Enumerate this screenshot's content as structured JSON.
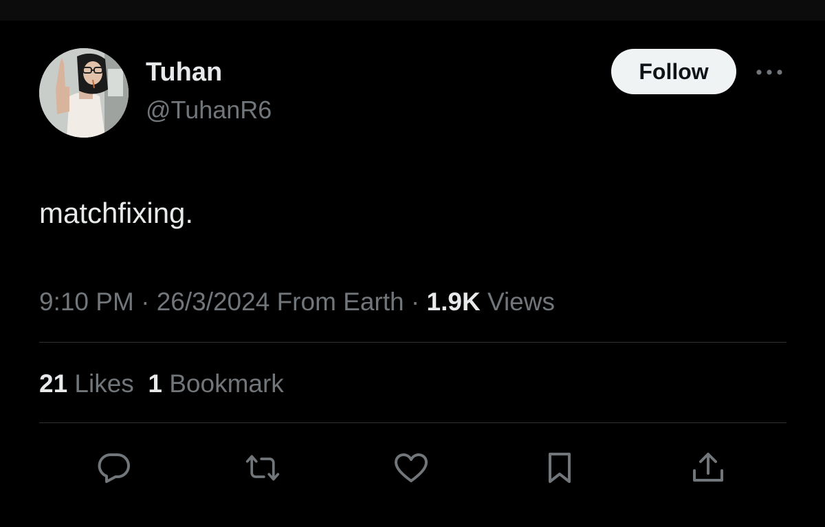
{
  "author": {
    "display_name": "Tuhan",
    "handle": "@TuhanR6"
  },
  "follow_label": "Follow",
  "more_icon": "more-horizontal-icon",
  "tweet": {
    "text": "matchfixing."
  },
  "meta": {
    "time": "9:10 PM",
    "sep1": " · ",
    "date": "26/3/2024",
    "source": " From Earth",
    "sep2": " · ",
    "views_count": "1.9K",
    "views_label": " Views"
  },
  "stats": {
    "likes_count": "21",
    "likes_label": " Likes",
    "bookmarks_count": "1",
    "bookmarks_label": " Bookmark"
  },
  "actions": [
    {
      "icon": "reply-icon"
    },
    {
      "icon": "retweet-icon"
    },
    {
      "icon": "like-icon"
    },
    {
      "icon": "bookmark-icon"
    },
    {
      "icon": "share-icon"
    }
  ],
  "colors": {
    "background": "#000000",
    "primary_text": "#e7e9ea",
    "secondary_text": "#71767b",
    "divider": "#2f3336",
    "follow_bg": "#eff3f4",
    "follow_text": "#0f1419"
  }
}
